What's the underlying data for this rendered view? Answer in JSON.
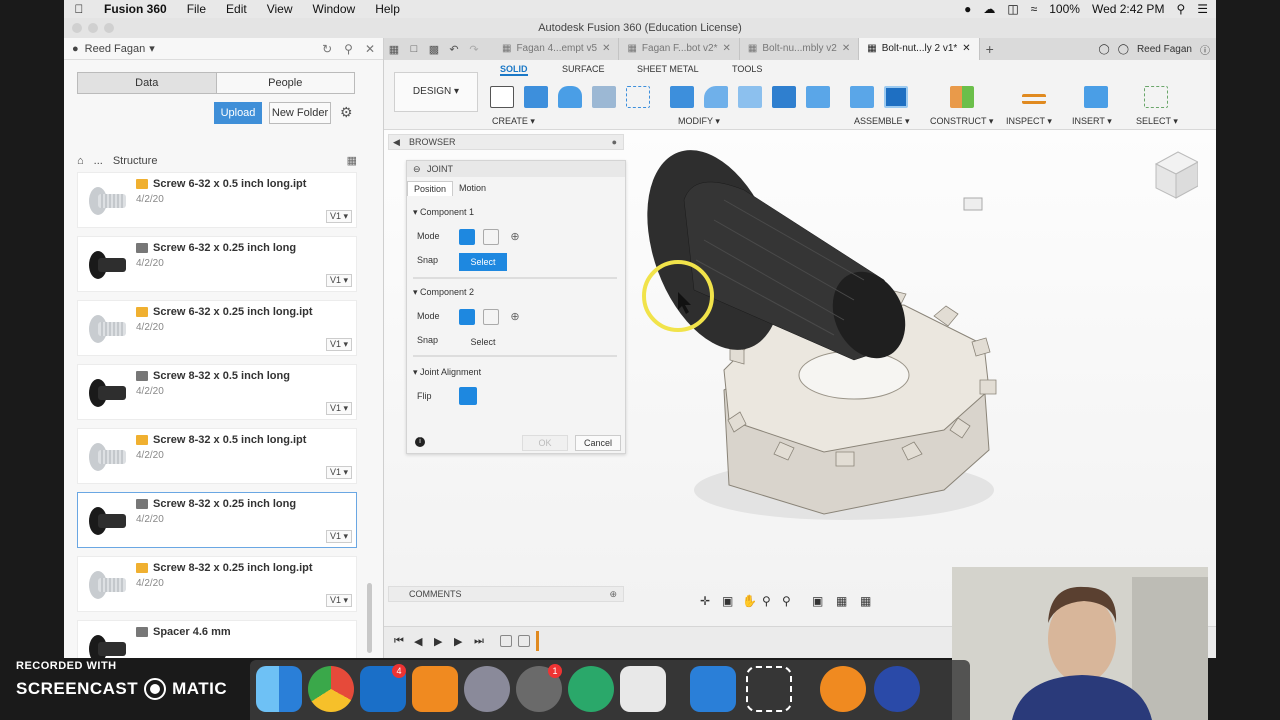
{
  "menubar": {
    "app_name": "Fusion 360",
    "items": [
      "File",
      "Edit",
      "View",
      "Window",
      "Help"
    ],
    "battery": "100%",
    "clock": "Wed 2:42 PM"
  },
  "window_title": "Autodesk Fusion 360 (Education License)",
  "data_panel": {
    "user_name": "Reed Fagan",
    "tabs": [
      "Data",
      "People"
    ],
    "upload_label": "Upload",
    "new_folder_label": "New Folder",
    "breadcrumb_ellipsis": "...",
    "breadcrumb_folder": "Structure",
    "partial_top_version": "V1",
    "files": [
      {
        "name": "Screw 6-32 x 0.5 inch long.ipt",
        "date": "4/2/20",
        "version": "V1",
        "type": "ipt"
      },
      {
        "name": "Screw 6-32 x 0.25 inch long",
        "date": "4/2/20",
        "version": "V1",
        "type": "f3d"
      },
      {
        "name": "Screw 6-32 x 0.25 inch long.ipt",
        "date": "4/2/20",
        "version": "V1",
        "type": "ipt"
      },
      {
        "name": "Screw 8-32 x 0.5 inch long",
        "date": "4/2/20",
        "version": "V1",
        "type": "f3d"
      },
      {
        "name": "Screw 8-32 x 0.5 inch long.ipt",
        "date": "4/2/20",
        "version": "V1",
        "type": "ipt"
      },
      {
        "name": "Screw 8-32 x 0.25 inch long",
        "date": "4/2/20",
        "version": "V1",
        "type": "f3d"
      },
      {
        "name": "Screw 8-32 x 0.25 inch long.ipt",
        "date": "4/2/20",
        "version": "V1",
        "type": "ipt"
      },
      {
        "name": "Spacer 4.6 mm",
        "date": "",
        "version": "",
        "type": "f3d"
      }
    ]
  },
  "doc_tabs": [
    {
      "label": "Fagan 4...empt v5",
      "active": false
    },
    {
      "label": "Fagan F...bot v2*",
      "active": false
    },
    {
      "label": "Bolt-nu...mbly v2",
      "active": false
    },
    {
      "label": "Bolt-nut...ly 2 v1*",
      "active": true
    }
  ],
  "tab_user": "Reed Fagan",
  "toolbar": {
    "workspace": "DESIGN",
    "workspace_tabs": [
      "SOLID",
      "SURFACE",
      "SHEET METAL",
      "TOOLS"
    ],
    "groups": [
      "CREATE",
      "MODIFY",
      "ASSEMBLE",
      "CONSTRUCT",
      "INSPECT",
      "INSERT",
      "SELECT"
    ]
  },
  "browser_label": "BROWSER",
  "comments_label": "COMMENTS",
  "joint_dialog": {
    "title": "JOINT",
    "tabs": [
      "Position",
      "Motion"
    ],
    "component1": "Component 1",
    "component2": "Component 2",
    "joint_alignment": "Joint Alignment",
    "mode_label": "Mode",
    "snap_label": "Snap",
    "flip_label": "Flip",
    "select_label": "Select",
    "ok_label": "OK",
    "cancel_label": "Cancel"
  },
  "watermark": {
    "line1": "RECORDED WITH",
    "line2a": "SCREENCAST",
    "line2b": "MATIC"
  },
  "dock_badges": [
    "4",
    "1"
  ],
  "colors": {
    "accent": "#1e88e0",
    "ipt_icon": "#f0b030",
    "selected_border": "#6aa7e3"
  }
}
